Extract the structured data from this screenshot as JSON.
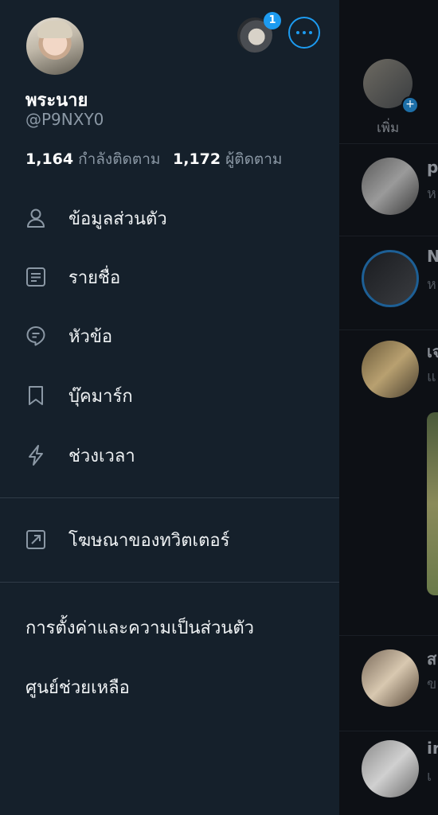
{
  "profile": {
    "display_name": "พระนาย",
    "handle": "@P9NXY0",
    "following_count": "1,164",
    "following_label": "กำลังติดตาม",
    "followers_count": "1,172",
    "followers_label": "ผู้ติดตาม"
  },
  "accounts": {
    "notification_badge": "1"
  },
  "menu": {
    "items": [
      {
        "label": "ข้อมูลส่วนตัว",
        "icon": "person-icon"
      },
      {
        "label": "รายชื่อ",
        "icon": "lists-icon"
      },
      {
        "label": "หัวข้อ",
        "icon": "topics-icon"
      },
      {
        "label": "บุ๊คมาร์ก",
        "icon": "bookmark-icon"
      },
      {
        "label": "ช่วงเวลา",
        "icon": "moments-icon"
      }
    ],
    "ads_label": "โฆษณาของทวิตเตอร์",
    "settings_label": "การตั้งค่าและความเป็นส่วนตัว",
    "help_label": "ศูนย์ช่วยเหลือ"
  },
  "feed": {
    "add_label": "เพิ่ม",
    "rows": [
      {
        "name": "p",
        "sub": "ห"
      },
      {
        "name": "N",
        "sub": "ห"
      },
      {
        "name": "เจ",
        "sub": "แ"
      },
      {
        "name": "ส",
        "sub": "ข"
      },
      {
        "name": "ir",
        "sub": "เ"
      }
    ]
  },
  "colors": {
    "drawer_bg": "#15202b",
    "accent": "#1d9bf0",
    "text_primary": "#ffffff",
    "text_secondary": "#8b98a5"
  }
}
